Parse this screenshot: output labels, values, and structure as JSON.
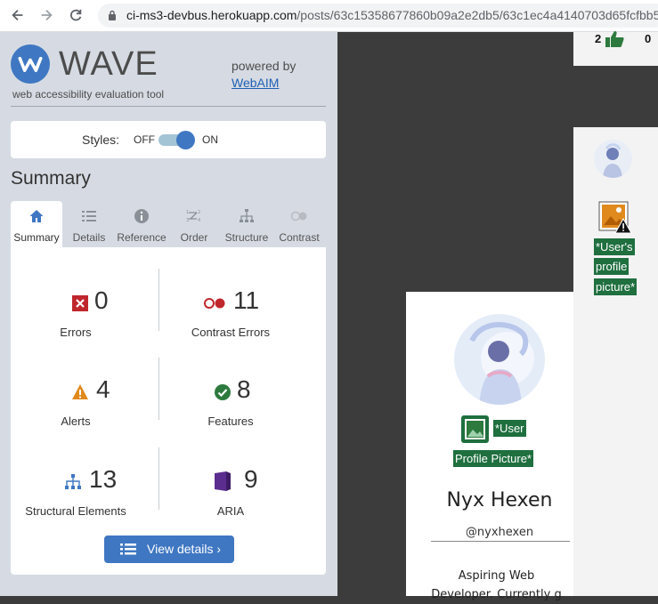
{
  "browser": {
    "url_host": "ci-ms3-devbus.herokuapp.com",
    "url_path": "/posts/63c15358677860b09a2e2db5/63c1ec4a4140703d65fcfbb5"
  },
  "wave": {
    "brand": "WAVE",
    "tagline": "web accessibility evaluation tool",
    "powered_by": "powered by",
    "webaim_link": "WebAIM",
    "styles_label": "Styles:",
    "off_label": "OFF",
    "on_label": "ON",
    "summary_title": "Summary",
    "tabs": [
      {
        "label": "Summary",
        "icon": "home-icon"
      },
      {
        "label": "Details",
        "icon": "list-icon"
      },
      {
        "label": "Reference",
        "icon": "info-icon"
      },
      {
        "label": "Order",
        "icon": "order-icon"
      },
      {
        "label": "Structure",
        "icon": "structure-icon"
      },
      {
        "label": "Contrast",
        "icon": "contrast-icon"
      }
    ],
    "stats": {
      "errors": {
        "count": "0",
        "label": "Errors"
      },
      "contrast_errors": {
        "count": "11",
        "label": "Contrast Errors"
      },
      "alerts": {
        "count": "4",
        "label": "Alerts"
      },
      "features": {
        "count": "8",
        "label": "Features"
      },
      "structural": {
        "count": "13",
        "label": "Structural Elements"
      },
      "aria": {
        "count": "9",
        "label": "ARIA"
      }
    },
    "view_details": "View details ›",
    "colors": {
      "accent": "#3f77c2",
      "error": "#c0272d",
      "alert": "#e08a1e",
      "feature": "#2d7a3e",
      "aria": "#5b2d8e"
    }
  },
  "page": {
    "likes_count": "2",
    "dislikes_count": "0",
    "side_alt_label_1": "*User's",
    "side_alt_label_2": "profile",
    "side_alt_label_3": "picture*",
    "main_alt_label_1": "*User",
    "main_alt_label_2": "Profile Picture*",
    "profile_name": "Nyx Hexen",
    "handle": "@nyxhexen",
    "bio_line_1": "Aspiring Web",
    "bio_line_2": "Developer. Currently g"
  }
}
